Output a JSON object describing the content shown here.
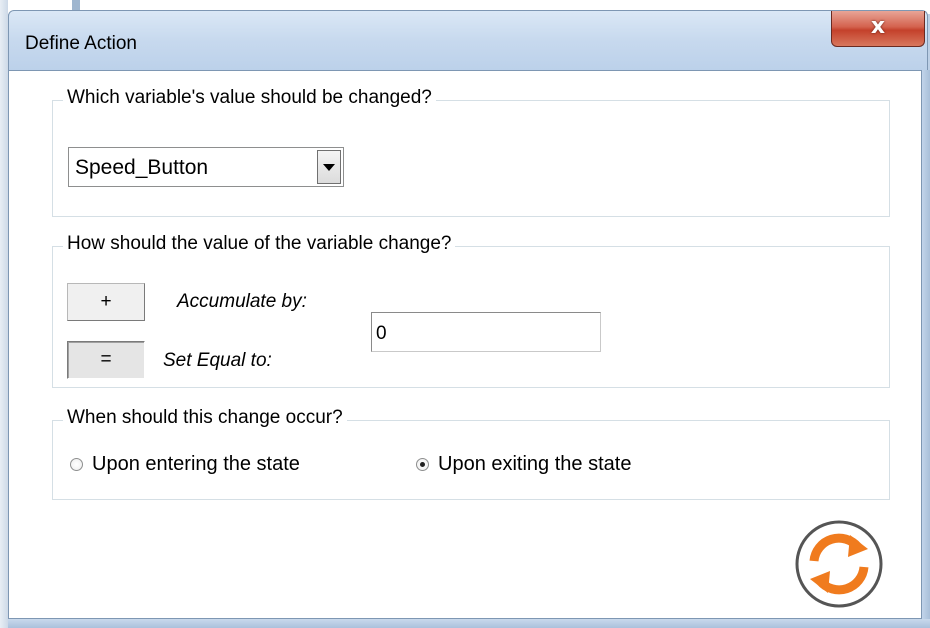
{
  "window": {
    "title": "Define Action",
    "close_glyph": "x"
  },
  "variable_group": {
    "title": "Which variable's value should be changed?",
    "selected_variable": "Speed_Button"
  },
  "change_group": {
    "title": "How should the value of the variable change?",
    "accumulate_button": "+",
    "accumulate_label": "Accumulate by:",
    "set_equal_button": "=",
    "set_equal_label": "Set Equal to:",
    "value": "0",
    "selected_mode": "set_equal"
  },
  "timing_group": {
    "title": "When should this change occur?",
    "options": [
      {
        "label": "Upon entering the state",
        "checked": false
      },
      {
        "label": "Upon exiting the state",
        "checked": true
      }
    ]
  },
  "icons": {
    "refresh": "refresh-icon",
    "dropdown": "chevron-down-icon"
  },
  "colors": {
    "accent_orange": "#f07b1e",
    "close_red": "#c4412b",
    "titlebar": "#c7d9ee"
  }
}
